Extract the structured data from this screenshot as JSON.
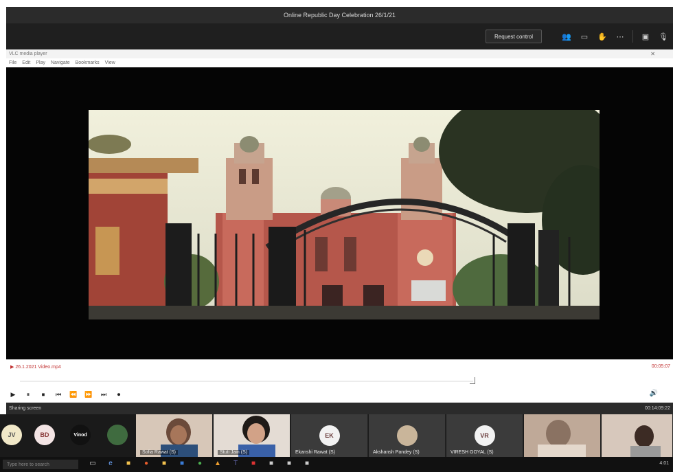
{
  "window": {
    "title": "Online Republic Day Celebration 26/1/21"
  },
  "meeting_toolbar": {
    "resume_label": "Request control",
    "icons": [
      "people-icon",
      "chat-icon",
      "hand-icon",
      "more-icon",
      "camera-icon",
      "mic-icon"
    ]
  },
  "player": {
    "title": "VLC media player",
    "close_glyph": "✕",
    "menu": [
      "File",
      "Edit",
      "Play",
      "Navigate",
      "Bookmarks",
      "View"
    ],
    "media_path": "▶ 26.1.2021 Video.mp4",
    "media_time": "00:05:07",
    "controls": [
      "▶",
      "⏸",
      "⏹",
      "⏮",
      "⏪",
      "⏩",
      "⏭",
      "⏺"
    ],
    "volume_glyph": "🔊"
  },
  "teams_status": {
    "left": "Sharing screen",
    "right": "00:14:09:22"
  },
  "participants": {
    "mini": [
      {
        "initials": "JV",
        "bg": "#f1e8c8",
        "fg": "#555"
      },
      {
        "initials": "BD",
        "bg": "#f3e4e4",
        "fg": "#8a3a3a"
      },
      {
        "initials": "Vinod",
        "bg": "#111111",
        "fg": "#ffffff"
      },
      {
        "initials": "",
        "bg": "#3f6b3f",
        "fg": "#ffffff"
      }
    ],
    "tiles": [
      {
        "name": "Sofia Rawat (S)",
        "type": "photo"
      },
      {
        "name": "Stuti Jain (S)",
        "type": "photo"
      },
      {
        "name": "Ekanshi Rawat (S)",
        "initials": "EK",
        "type": "avatar"
      },
      {
        "name": "Akshansh Pandey (S)",
        "initials": "",
        "type": "avatar"
      },
      {
        "name": "VIRESH GOYAL (S)",
        "initials": "VR",
        "type": "avatar"
      },
      {
        "name": "",
        "type": "photo"
      },
      {
        "name": "",
        "type": "photo"
      }
    ]
  },
  "taskbar": {
    "search_placeholder": "Type here to search",
    "clock": "4:01"
  }
}
